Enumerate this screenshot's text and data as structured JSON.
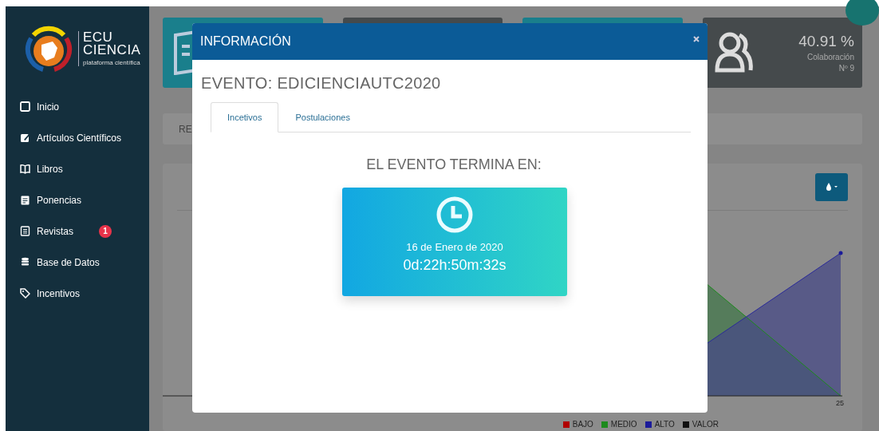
{
  "sidebar": {
    "logo": {
      "line_1": "ECU",
      "line_2": "CIENCIA",
      "subtitle": "plataforma científica"
    },
    "items": [
      {
        "label": "Inicio",
        "kind": "square"
      },
      {
        "label": "Artículos Científicos",
        "kind": "edit"
      },
      {
        "label": "Libros",
        "kind": "book"
      },
      {
        "label": "Ponencias",
        "kind": "calendar"
      },
      {
        "label": "Revistas",
        "kind": "document",
        "badge": "1"
      },
      {
        "label": "Base de Datos",
        "kind": "database"
      },
      {
        "label": "Incentivos",
        "kind": "tag"
      }
    ]
  },
  "stat_cards": [
    {
      "kind": "book",
      "color": "#1a7f8c"
    },
    {
      "kind": "plain",
      "color": "#454a4c"
    },
    {
      "kind": "plain",
      "color": "#1a7f8c"
    },
    {
      "kind": "people",
      "color": "#454a4c",
      "value": "40.91 %",
      "label": "Colaboración",
      "sublabel": "Nº 9"
    }
  ],
  "report_bar": {
    "text": "RE"
  },
  "chart_panel": {
    "axis_label": "25",
    "legend": [
      {
        "label": "BAJO",
        "color": "#b00000"
      },
      {
        "label": "MEDIO",
        "color": "#1d8a1d"
      },
      {
        "label": "ALTO",
        "color": "#1b1b9a"
      },
      {
        "label": "VALOR",
        "color": "#111111"
      }
    ]
  },
  "modal": {
    "title": "INFORMACIÓN",
    "heading": "EVENTO: EDICIENCIAUTC2020",
    "tabs": [
      {
        "label": "Incetivos",
        "selected": true
      },
      {
        "label": "Postulaciones",
        "selected": false
      }
    ],
    "countdown_title": "EL EVENTO TERMINA EN:",
    "date": "16 de Enero de 2020",
    "remaining": "0d:22h:50m:32s"
  }
}
